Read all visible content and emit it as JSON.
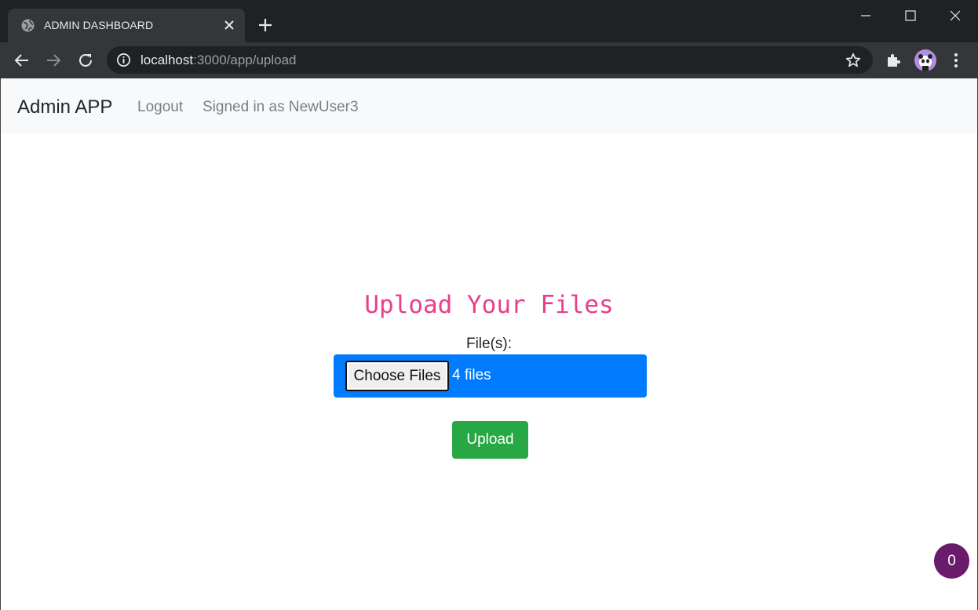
{
  "browser": {
    "tab_title": "ADMIN DASHBOARD",
    "url_host": "localhost",
    "url_path": ":3000/app/upload"
  },
  "navbar": {
    "brand": "Admin APP",
    "logout": "Logout",
    "signed_in": "Signed in as NewUser3"
  },
  "main": {
    "heading": "Upload Your Files",
    "files_label": "File(s):",
    "choose_button": "Choose Files",
    "file_count": "4 files",
    "upload_button": "Upload"
  },
  "badge": {
    "count": "0"
  },
  "colors": {
    "accent_pink": "#e83e8c",
    "file_box_blue": "#007bff",
    "upload_green": "#28a745",
    "badge_purple": "#6a1b6a"
  }
}
